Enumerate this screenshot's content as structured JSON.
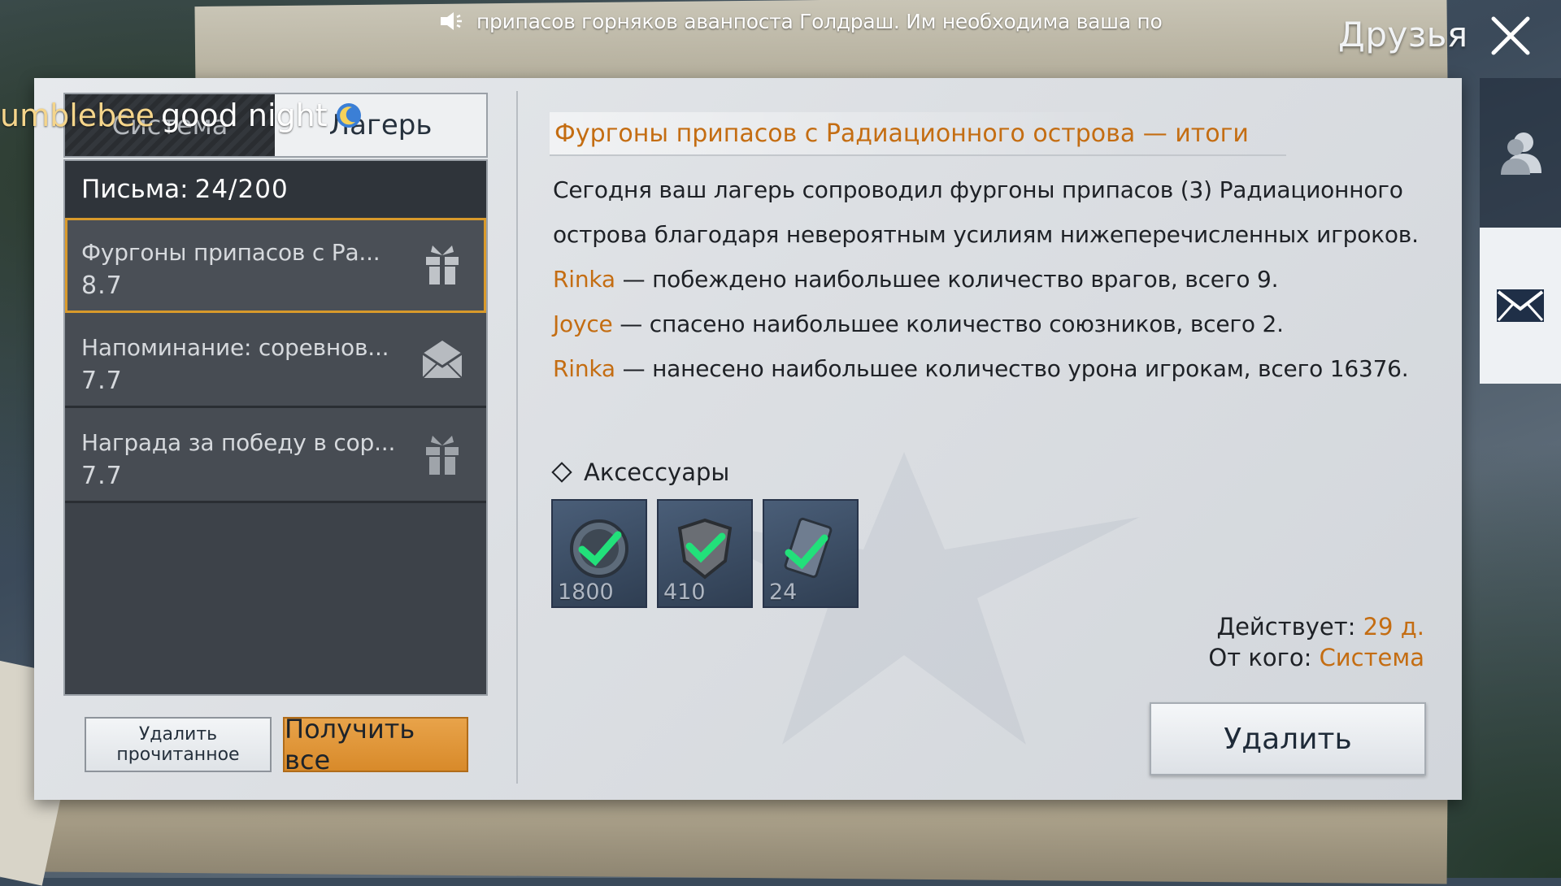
{
  "ticker": {
    "text": "припасов горняков аванпоста Голдраш. Им необходима ваша по"
  },
  "header": {
    "title": "Друзья"
  },
  "chat": {
    "nick": "umblebee",
    "message": "good night"
  },
  "tabs": {
    "system": "Система",
    "camp": "Лагерь"
  },
  "list": {
    "letters_label": "Письма:",
    "letters_count": "24/200",
    "items": [
      {
        "subject": "Фургоны припасов с Ра...",
        "date": "8.7",
        "icon": "gift-icon",
        "selected": true
      },
      {
        "subject": "Напоминание: соревнов...",
        "date": "7.7",
        "icon": "envelope-icon",
        "selected": false
      },
      {
        "subject": "Награда за победу в сор...",
        "date": "7.7",
        "icon": "gift-icon",
        "selected": false
      }
    ]
  },
  "buttons": {
    "delete_read": "Удалить прочитанное",
    "get_all": "Получить все",
    "delete": "Удалить"
  },
  "mail": {
    "title": "Фургоны припасов с Радиационного острова — итоги",
    "intro_1": "Сегодня ваш лагерь сопроводил фургоны припасов (3) Радиационного",
    "intro_2": "острова благодаря невероятным усилиям нижеперечисленных игроков.",
    "lines": [
      {
        "name": "Rinka",
        "text": " — побеждено наибольшее количество врагов, всего 9."
      },
      {
        "name": "Joyce",
        "text": " — спасено наибольшее количество союзников, всего 2."
      },
      {
        "name": "Rinka",
        "text": " — нанесено наибольшее количество урона игрокам, всего 16376."
      }
    ],
    "attachments_label": "Аксессуары",
    "attachments": [
      {
        "icon": "coin-check-icon",
        "qty": "1800"
      },
      {
        "icon": "badge-check-icon",
        "qty": "410"
      },
      {
        "icon": "card-check-icon",
        "qty": "24"
      }
    ],
    "valid_label": "Действует:",
    "valid_value": "29 д.",
    "from_label": "От кого:",
    "from_value": "Система"
  },
  "colors": {
    "accent": "#c46d12",
    "selected_border": "#d99a2b",
    "get_all_bg": "#d88a2a"
  }
}
